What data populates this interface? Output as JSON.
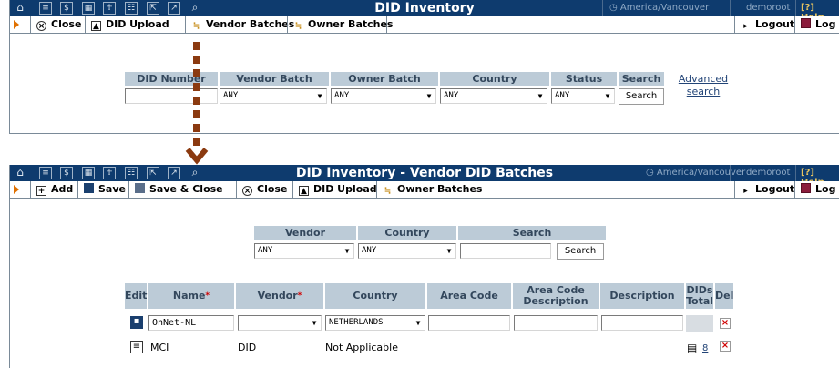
{
  "colors": {
    "topbar": "#0e3b6e",
    "header_cell": "#bccbd7",
    "arrow": "#8b3a10",
    "accent_orange": "#e07000"
  },
  "top_icons": [
    "home-icon",
    "list-icon",
    "dollar-icon",
    "grid-icon",
    "person-icon",
    "org-icon",
    "export-icon",
    "chart-icon",
    "search-icon"
  ],
  "screen1": {
    "title": "DID Inventory",
    "timezone": "America/Vancouver",
    "user": "demoroot",
    "help": "Help",
    "toolbar": {
      "close": "Close",
      "did_upload": "DID Upload",
      "vendor_batches": "Vendor Batches",
      "owner_batches": "Owner Batches",
      "logout": "Logout",
      "log": "Log"
    },
    "filter": {
      "headers": {
        "did_number": "DID Number",
        "vendor_batch": "Vendor Batch",
        "owner_batch": "Owner Batch",
        "country": "Country",
        "status": "Status",
        "search": "Search"
      },
      "did_number_value": "",
      "vendor_batch_value": "ANY",
      "owner_batch_value": "ANY",
      "country_value": "ANY",
      "status_value": "ANY",
      "search_button": "Search",
      "advanced_search": "Advanced search"
    }
  },
  "screen2": {
    "title": "DID Inventory - Vendor DID Batches",
    "timezone": "America/Vancouver",
    "user": "demoroot",
    "help": "Help",
    "toolbar": {
      "add": "Add",
      "save": "Save",
      "save_close": "Save & Close",
      "close": "Close",
      "did_upload": "DID Upload",
      "owner_batches": "Owner Batches",
      "logout": "Logout",
      "log": "Log"
    },
    "filter": {
      "headers": {
        "vendor": "Vendor",
        "country": "Country",
        "search": "Search"
      },
      "vendor_value": "ANY",
      "country_value": "ANY",
      "search_value": "",
      "search_button": "Search"
    },
    "table": {
      "headers": {
        "edit": "Edit",
        "name": "Name",
        "vendor": "Vendor",
        "country": "Country",
        "area_code": "Area Code",
        "area_code_desc": "Area Code Description",
        "description": "Description",
        "dids_total": "DIDs Total",
        "del": "Del"
      },
      "new_row": {
        "name": "OnNet-NL",
        "vendor": "",
        "country": "NETHERLANDS",
        "area_code": "",
        "area_code_desc": "",
        "description": ""
      },
      "rows": [
        {
          "name": "MCI",
          "vendor": "DID",
          "country": "Not Applicable",
          "dids_total": "8"
        }
      ]
    }
  }
}
